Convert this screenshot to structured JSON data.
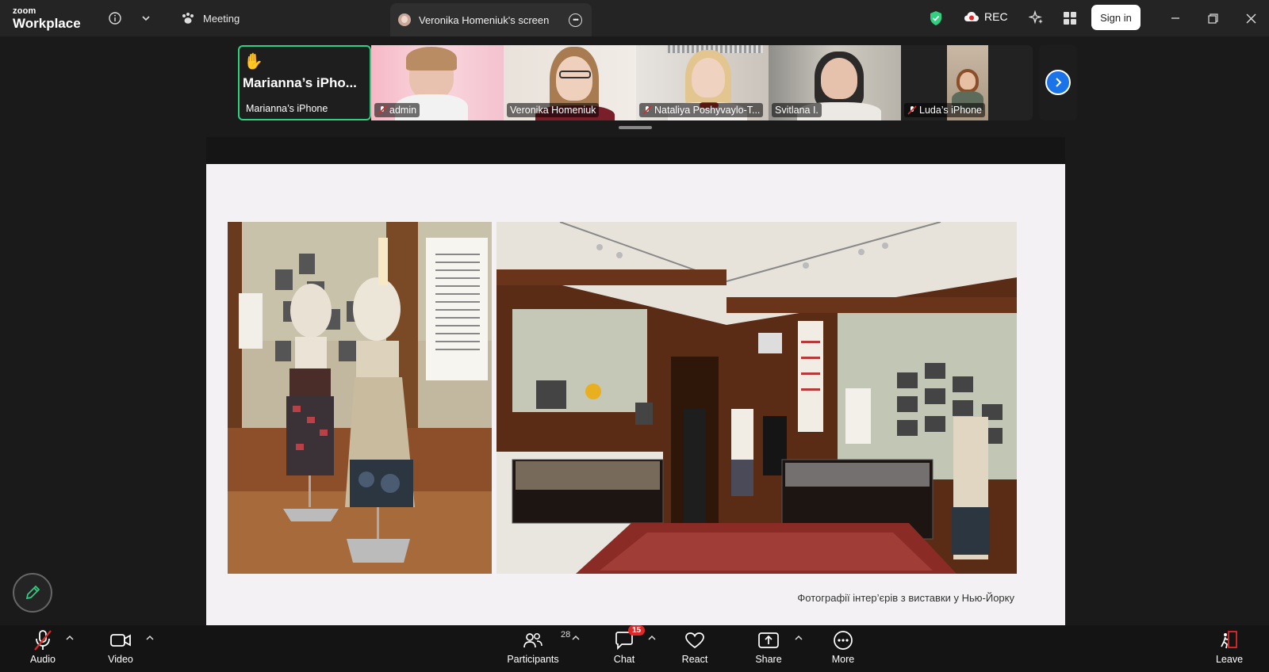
{
  "app": {
    "logo_line1": "zoom",
    "logo_line2": "Workplace"
  },
  "topbar": {
    "meeting_label": "Meeting",
    "screen_tab_label": "Veronika Homeniuk's screen",
    "rec_label": "REC",
    "signin_label": "Sign in"
  },
  "participants_strip": [
    {
      "name": "Marianna’s iPhone",
      "big_label": "Marianna’s  iPho...",
      "raised_hand": "✋",
      "active": true
    },
    {
      "name": "admin",
      "muted": true
    },
    {
      "name": "Veronika Homeniuk",
      "muted": false
    },
    {
      "name": "Nataliya Poshyvaylo-T...",
      "muted": true
    },
    {
      "name": "Svitlana I.",
      "muted": false
    },
    {
      "name": "Luda’s iPhone",
      "muted": true
    }
  ],
  "shared_slide": {
    "caption": "Фотографії інтер’єрів з виставки у Нью-Йорку"
  },
  "toolbar": {
    "audio_label": "Audio",
    "video_label": "Video",
    "participants_label": "Participants",
    "participants_count": "28",
    "chat_label": "Chat",
    "chat_badge": "15",
    "react_label": "React",
    "share_label": "Share",
    "more_label": "More",
    "leave_label": "Leave"
  },
  "colors": {
    "accent_green": "#2fd07f",
    "accent_blue": "#1a73e8",
    "alert_red": "#e02828",
    "bar_bg": "#242424"
  }
}
